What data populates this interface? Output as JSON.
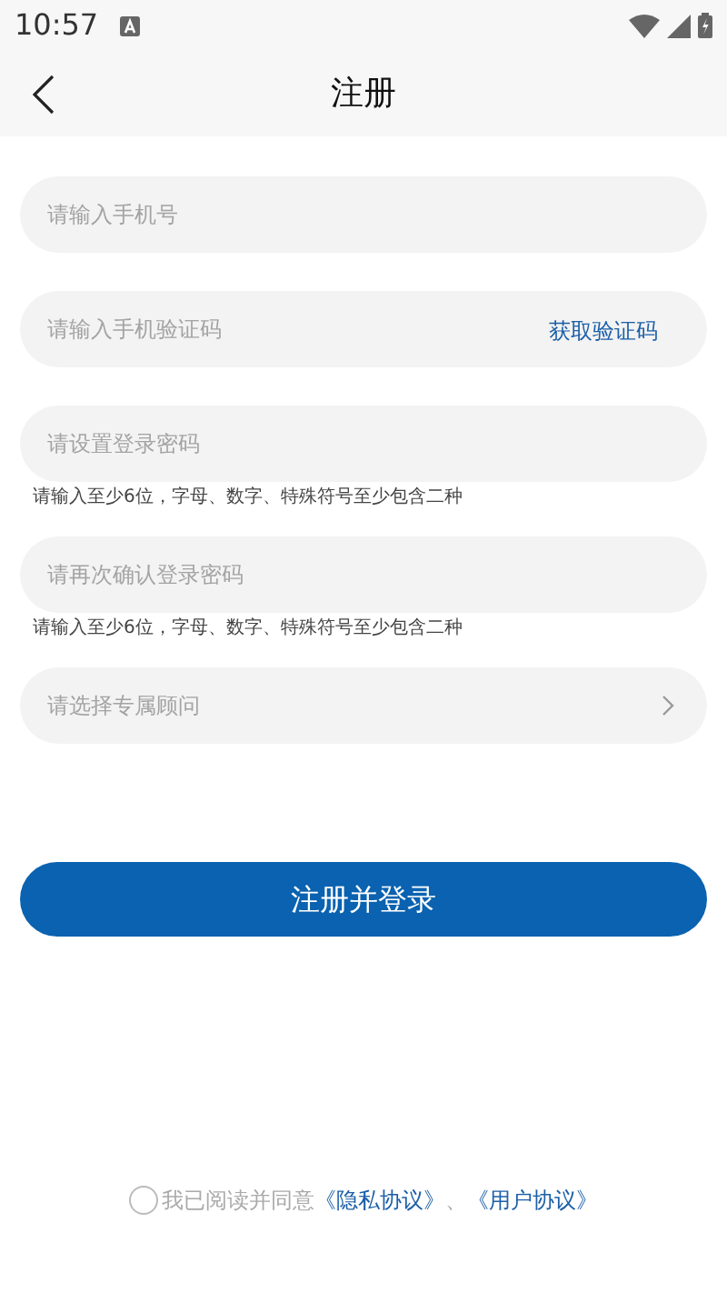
{
  "status_bar": {
    "time": "10:57"
  },
  "header": {
    "title": "注册"
  },
  "fields": [
    {
      "kind": "input",
      "placeholder": "请输入手机号"
    },
    {
      "kind": "input",
      "placeholder": "请输入手机验证码",
      "action": "获取验证码"
    },
    {
      "kind": "input",
      "placeholder": "请设置登录密码",
      "hint": "请输入至少6位，字母、数字、特殊符号至少包含二种"
    },
    {
      "kind": "input",
      "placeholder": "请再次确认登录密码",
      "hint": "请输入至少6位，字母、数字、特殊符号至少包含二种"
    },
    {
      "kind": "picker",
      "placeholder": "请选择专属顾问"
    }
  ],
  "submit": "注册并登录",
  "agreement": {
    "checked": false,
    "text": "我已阅读并同意",
    "links": [
      "《隐私协议》",
      "《用户协议》"
    ],
    "separator": "、"
  }
}
